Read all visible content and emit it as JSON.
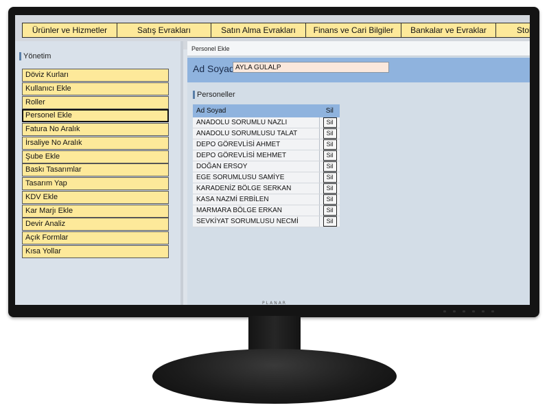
{
  "monitor": {
    "brand": "PLANAR"
  },
  "topnav": {
    "items": [
      {
        "label": "Ürünler ve Hizmetler"
      },
      {
        "label": "Satış Evrakları"
      },
      {
        "label": "Satın Alma Evrakları"
      },
      {
        "label": "Finans ve Cari Bilgiler"
      },
      {
        "label": "Bankalar ve Evraklar"
      },
      {
        "label": "Stok"
      }
    ]
  },
  "sidebar": {
    "title": "Yönetim",
    "items": [
      {
        "label": "Döviz Kurları"
      },
      {
        "label": "Kullanıcı Ekle"
      },
      {
        "label": "Roller"
      },
      {
        "label": "Personel Ekle"
      },
      {
        "label": "Fatura No Aralık"
      },
      {
        "label": "İrsaliye No Aralık"
      },
      {
        "label": "Şube Ekle"
      },
      {
        "label": "Baskı Tasarımlar"
      },
      {
        "label": "Tasarım Yap"
      },
      {
        "label": "KDV Ekle"
      },
      {
        "label": "Kar Marjı Ekle"
      },
      {
        "label": "Devir Analiz"
      },
      {
        "label": "Açık Formlar"
      },
      {
        "label": "Kısa Yollar"
      }
    ],
    "active_item": "Personel Ekle"
  },
  "panel": {
    "header": "Personel Ekle",
    "form": {
      "label": "Ad Soyad",
      "value": "AYLA GÜLALP"
    },
    "section_title": "Personeller",
    "table": {
      "columns": [
        "Ad Soyad",
        "Sil"
      ],
      "delete_label": "Sil",
      "rows": [
        "ANADOLU SORUMLU NAZLI",
        "ANADOLU SORUMLUSU TALAT",
        "DEPO GÖREVLİSİ AHMET",
        "DEPO GÖREVLİSİ MEHMET",
        "DOĞAN ERSOY",
        "EGE SORUMLUSU SAMİYE",
        "KARADENİZ BÖLGE SERKAN",
        "KASA NAZMİ ERBİLEN",
        "MARMARA BÖLGE ERKAN",
        "SEVKİYAT SORUMLUSU NECMİ"
      ]
    }
  },
  "colors": {
    "nav_button": "#fde99a",
    "form_bar": "#8fb3de",
    "input_bg": "#fbe8dc",
    "monitor_bezel": "#141414"
  }
}
